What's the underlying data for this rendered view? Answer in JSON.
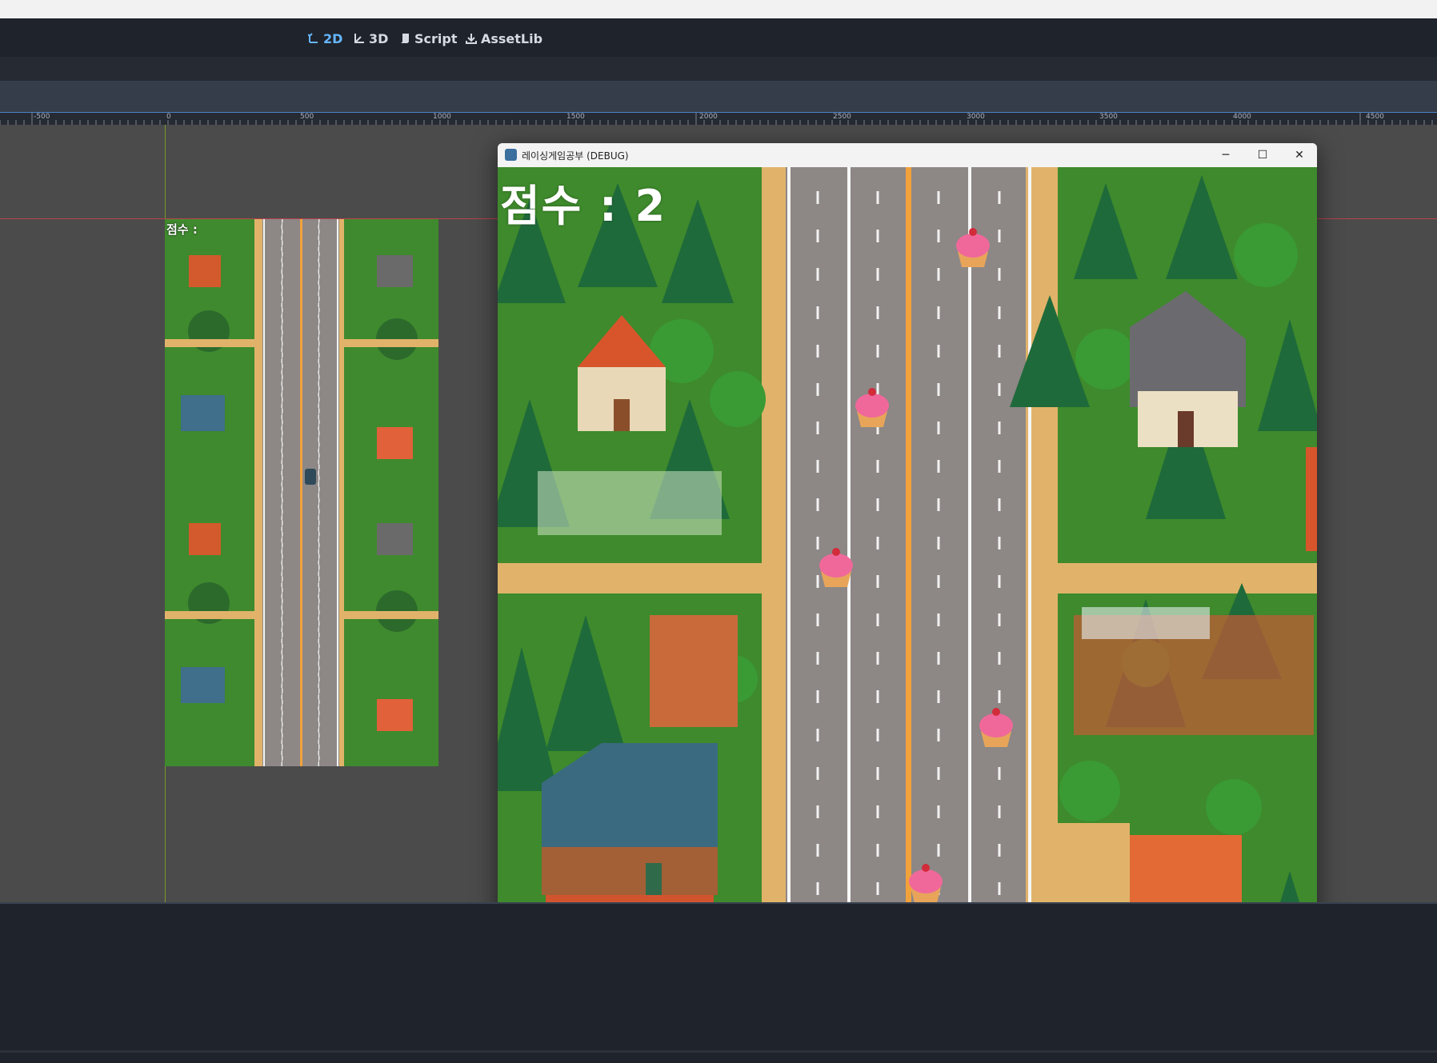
{
  "workspaces": [
    {
      "label": "2D",
      "icon": "2d-icon",
      "active": true
    },
    {
      "label": "3D",
      "icon": "3d-icon",
      "active": false
    },
    {
      "label": "Script",
      "icon": "script-icon",
      "active": false
    },
    {
      "label": "AssetLib",
      "icon": "assetlib-icon",
      "active": false
    }
  ],
  "ruler": {
    "labels": [
      "-500",
      "0",
      "500",
      "1000",
      "1500",
      "2000",
      "2500",
      "3000",
      "3500",
      "4000",
      "4500"
    ]
  },
  "editor_canvas": {
    "score_label": "점수 :"
  },
  "game_window": {
    "title": "레이싱게임공부 (DEBUG)",
    "score_text": "점수 : 2",
    "minimize_label": "─",
    "maximize_label": "☐",
    "close_label": "✕",
    "cupcake_count": 5
  },
  "colors": {
    "accent": "#66b6ff",
    "road": "#8c8684",
    "lane_orange": "#f2a23a",
    "grass": "#3e8a2c",
    "dirt": "#e6b86a"
  }
}
